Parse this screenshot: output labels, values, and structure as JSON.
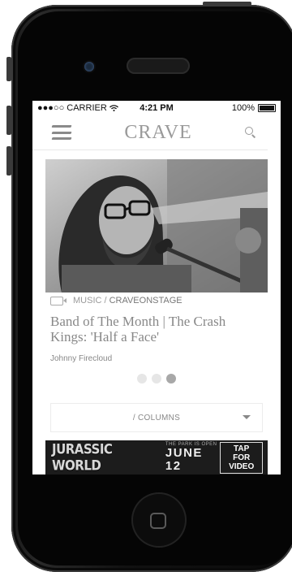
{
  "status_bar": {
    "carrier": "●●●○○ CARRIER",
    "time": "4:21 PM",
    "battery": "100%"
  },
  "header": {
    "logo": "CRAVE"
  },
  "article": {
    "category_prefix": "MUSIC /",
    "category_main": "CRAVEONSTAGE",
    "title": "Band of The Month | The Crash Kings: 'Half a Face'",
    "author": "Johnny Firecloud"
  },
  "carousel": {
    "active_index": 2,
    "count": 3
  },
  "columns_select": {
    "label": "/ COLUMNS"
  },
  "ad": {
    "brand": "JURASSIC WORLD",
    "tagline": "THE PARK IS OPEN",
    "date": "JUNE 12",
    "cta": "TAP FOR VIDEO",
    "cta_line1": "TAP FOR",
    "cta_line2": "VIDEO"
  }
}
